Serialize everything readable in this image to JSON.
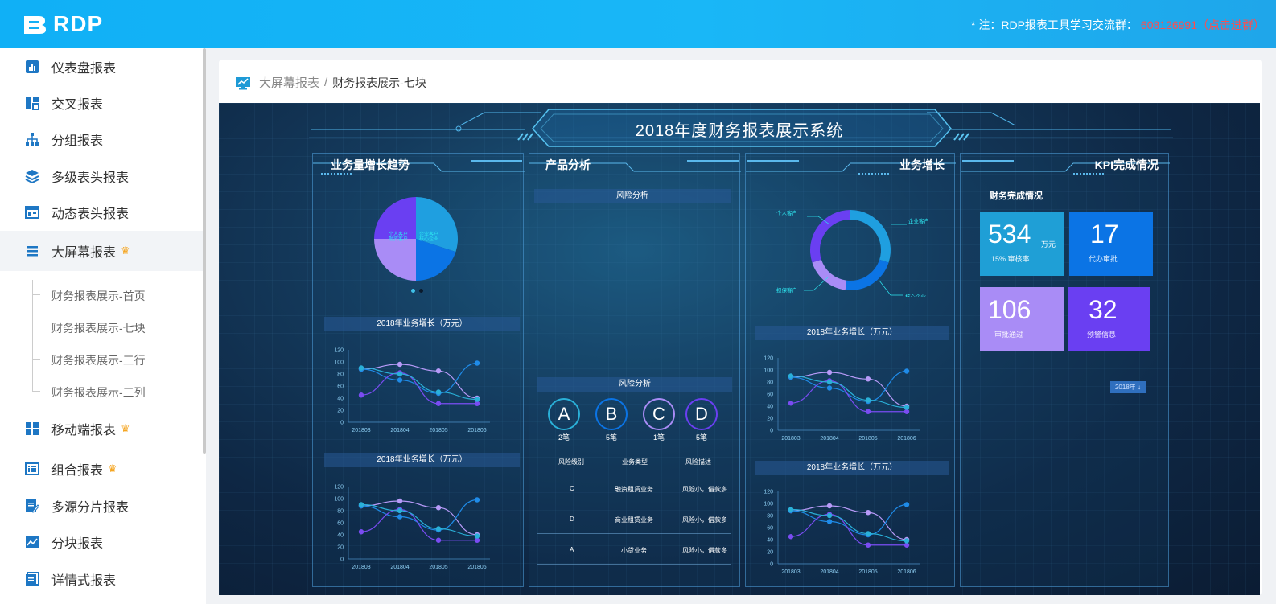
{
  "header": {
    "logo_text": "RDP",
    "notice_prefix": "* 注：RDP报表工具学习交流群：",
    "notice_qq": "608126991",
    "notice_click": "（点击进群）"
  },
  "sidebar": {
    "items": [
      {
        "label": "仪表盘报表",
        "icon": "bar-chart-icon"
      },
      {
        "label": "交叉报表",
        "icon": "cross-table-icon"
      },
      {
        "label": "分组报表",
        "icon": "sitemap-icon"
      },
      {
        "label": "多级表头报表",
        "icon": "layers-icon"
      },
      {
        "label": "动态表头报表",
        "icon": "dynamic-header-icon"
      },
      {
        "label": "大屏幕报表",
        "icon": "list-icon",
        "crown": true
      },
      {
        "label": "移动端报表",
        "icon": "grid-icon",
        "crown": true
      },
      {
        "label": "组合报表",
        "icon": "combo-list-icon",
        "crown": true
      },
      {
        "label": "多源分片报表",
        "icon": "edit-doc-icon"
      },
      {
        "label": "分块报表",
        "icon": "image-chart-icon"
      },
      {
        "label": "详情式报表",
        "icon": "detail-doc-icon"
      }
    ],
    "sub_items": [
      "财务报表展示-首页",
      "财务报表展示-七块",
      "财务报表展示-三行",
      "财务报表展示-三列"
    ]
  },
  "breadcrumb": {
    "parent": "大屏幕报表",
    "separator": "/",
    "current": "财务报表展示-七块"
  },
  "dashboard": {
    "title": "2018年度财务报表展示系统",
    "panel1_title": "业务量增长趋势",
    "panel2_title": "产品分析",
    "panel3_title": "业务增长",
    "panel4_title": "KPI完成情况",
    "chart_title": "2018年业务增长（万元）",
    "risk_title": "风险分析",
    "risk_title2": "风险分析",
    "finance_title": "财务完成情况",
    "year_button": "2018年 ↓",
    "pie_labels": [
      "个人客户",
      "企业客户",
      "融资客户",
      "核心企业"
    ],
    "donut_labels": {
      "personal": "个人客户",
      "enterprise": "企业客户",
      "finance": "担保客户",
      "core": "核心企业"
    }
  },
  "chart_data": [
    {
      "type": "pie",
      "categories": [
        "个人客户",
        "企业客户",
        "核心企业",
        "融资客户"
      ],
      "values": [
        30,
        20,
        25,
        25
      ],
      "colors": [
        "#1f9fe0",
        "#0b74e5",
        "#a98cf6",
        "#6a3ff2"
      ]
    },
    {
      "type": "line",
      "title": "2018年业务增长（万元）",
      "x": [
        "201803",
        "201804",
        "201805",
        "201806"
      ],
      "ylim": [
        0,
        120
      ],
      "yticks": [
        0,
        20,
        40,
        60,
        80,
        100,
        120
      ],
      "series": [
        {
          "values": [
            88,
            96,
            85,
            40
          ],
          "color": "#b79af8"
        },
        {
          "values": [
            88,
            70,
            48,
            98
          ],
          "color": "#1f8be8"
        },
        {
          "values": [
            45,
            82,
            31,
            31
          ],
          "color": "#7a4cf2"
        },
        {
          "values": [
            90,
            80,
            50,
            38
          ],
          "color": "#2ab0d8"
        }
      ]
    },
    {
      "type": "table",
      "columns": [
        "风险级别",
        "业务类型",
        "风险描述"
      ],
      "rows": [
        [
          "C",
          "融资租赁业务",
          "风险小，借款多"
        ],
        [
          "D",
          "商业租赁业务",
          "风险小，借款多"
        ],
        [
          "A",
          "小贷业务",
          "风险小，借款多"
        ]
      ]
    },
    {
      "type": "bar",
      "categories": [
        "A",
        "B",
        "C",
        "D"
      ],
      "values": [
        2,
        5,
        1,
        5
      ],
      "value_labels": [
        "2笔",
        "5笔",
        "1笔",
        "5笔"
      ]
    },
    {
      "type": "pie",
      "categories": [
        "个人客户",
        "企业客户",
        "核心企业",
        "担保客户"
      ],
      "values": [
        30,
        22,
        18,
        30
      ],
      "colors": [
        "#1f9fe0",
        "#0b74e5",
        "#a98cf6",
        "#6a3ff2"
      ]
    }
  ],
  "kpi": [
    {
      "value": "534",
      "unit": "万元",
      "label": "15% 审核率",
      "color": "#1f9fd6"
    },
    {
      "value": "17",
      "unit": "",
      "label": "代办审批",
      "color": "#0b74e5"
    },
    {
      "value": "106",
      "unit": "",
      "label": "审批通过",
      "color": "#a98cf6"
    },
    {
      "value": "32",
      "unit": "",
      "label": "预警信息",
      "color": "#6a3ff2"
    }
  ]
}
